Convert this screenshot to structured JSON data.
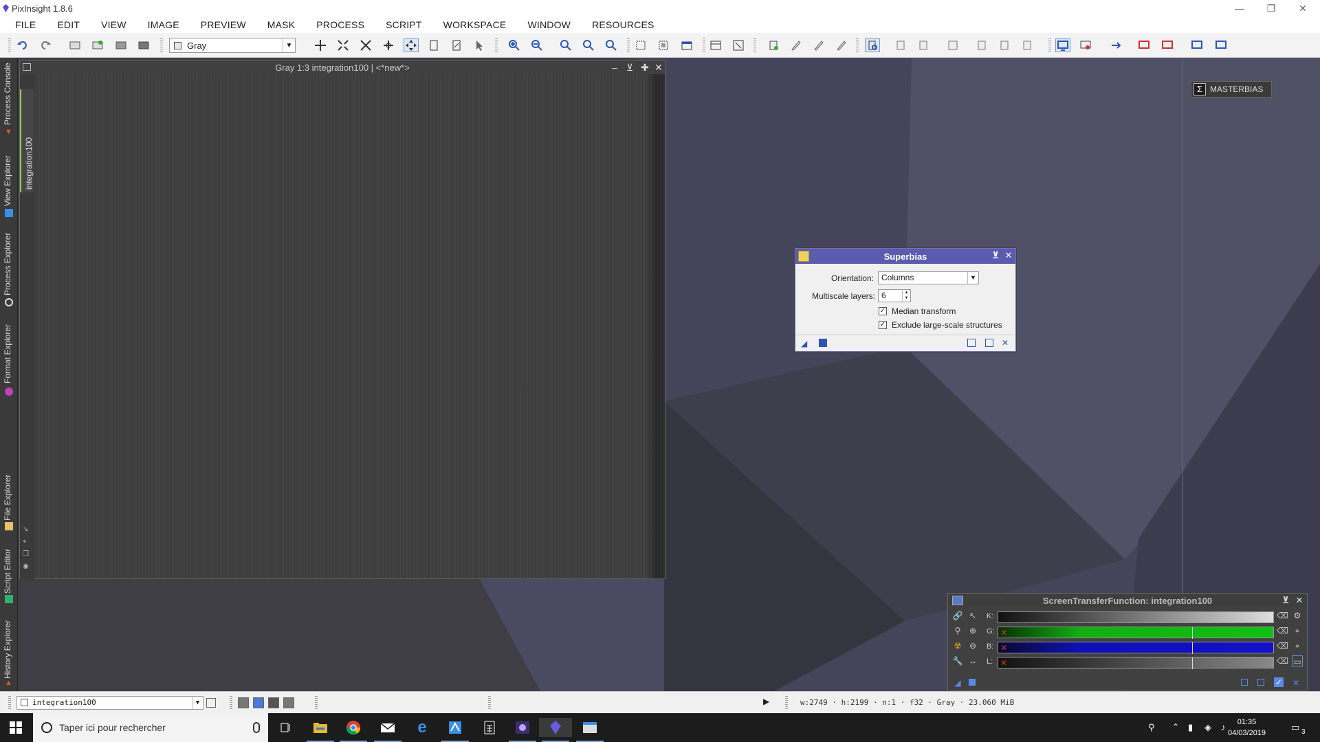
{
  "window": {
    "title": "PixInsight 1.8.6"
  },
  "menu": [
    "FILE",
    "EDIT",
    "VIEW",
    "IMAGE",
    "PREVIEW",
    "MASK",
    "PROCESS",
    "SCRIPT",
    "WORKSPACE",
    "WINDOW",
    "RESOURCES"
  ],
  "toolbar": {
    "mask_mode": "Gray"
  },
  "left_dock": {
    "tabs": [
      "Process Console",
      "View Explorer",
      "Process Explorer",
      "Format Explorer",
      "File Explorer",
      "Script Editor",
      "History Explorer"
    ]
  },
  "image_window": {
    "title": "Gray 1:3 integration100 | <*new*>",
    "tab_label": "integration100"
  },
  "superbias": {
    "title": "Superbias",
    "orientation_label": "Orientation:",
    "orientation_value": "Columns",
    "layers_label": "Multiscale layers:",
    "layers_value": "6",
    "median_label": "Median transform",
    "median_checked": true,
    "exclude_label": "Exclude large-scale structures",
    "exclude_checked": true
  },
  "icon": {
    "masterbias_label": "MASTERBIAS"
  },
  "stf": {
    "title": "ScreenTransferFunction: integration100",
    "channels": [
      {
        "label": "K:",
        "color": "#2a2a2a"
      },
      {
        "label": "G:",
        "color": "#10b010"
      },
      {
        "label": "B:",
        "color": "#1010b8"
      },
      {
        "label": "L:",
        "color": "#555555"
      }
    ]
  },
  "status": {
    "view": "integration100",
    "info": "w:2749 · h:2199 · n:1 · f32 · Gray · 23.060 MiB"
  },
  "taskbar": {
    "search_placeholder": "Taper ici pour rechercher",
    "time": "01:35",
    "date": "04/03/2019",
    "notifications": "3"
  }
}
